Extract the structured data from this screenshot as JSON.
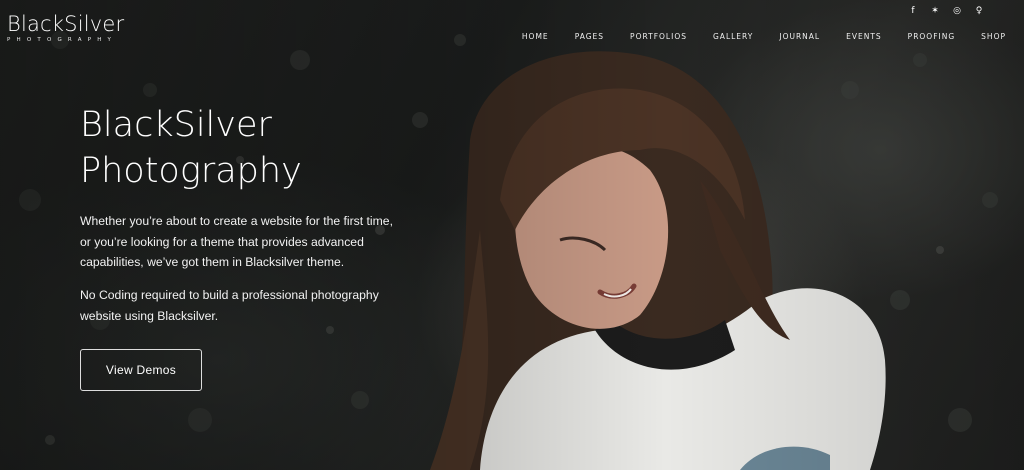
{
  "logo": {
    "main": "BlackSilver",
    "sub": "PHOTOGRAPHY"
  },
  "social": [
    {
      "icon": "facebook-icon",
      "glyph": "f"
    },
    {
      "icon": "twitter-icon",
      "glyph": "✶"
    },
    {
      "icon": "instagram-icon",
      "glyph": "◎"
    },
    {
      "icon": "snapchat-icon",
      "glyph": "♀"
    }
  ],
  "nav": [
    "HOME",
    "PAGES",
    "PORTFOLIOS",
    "GALLERY",
    "JOURNAL",
    "EVENTS",
    "PROOFING",
    "SHOP"
  ],
  "hero": {
    "title_line1": "BlackSilver",
    "title_line2": "Photography",
    "paragraph1": "Whether you’re about to create a website for the first time, or you’re looking for a theme that provides advanced capabilities, we’ve got them in Blacksilver theme.",
    "paragraph2": "No Coding required to build a professional photography website using Blacksilver.",
    "button_label": "View Demos"
  }
}
